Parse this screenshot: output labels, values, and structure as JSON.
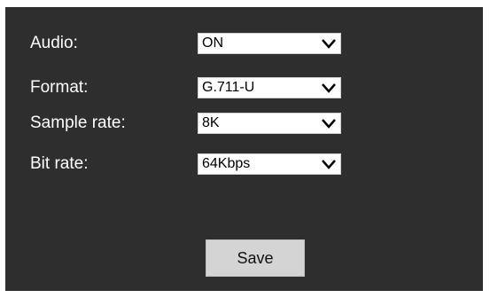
{
  "fields": [
    {
      "label": "Audio:",
      "value": "ON"
    },
    {
      "label": "Format:",
      "value": "G.711-U"
    },
    {
      "label": "Sample rate:",
      "value": "8K"
    },
    {
      "label": "Bit rate:",
      "value": "64Kbps"
    }
  ],
  "save_label": "Save",
  "colors": {
    "panel_background": "#2e2e2e",
    "label_text": "#ffffff",
    "select_background": "#ffffff",
    "button_background": "#d4d4d4"
  },
  "icons": {
    "dropdown": "chevron-down-icon"
  }
}
